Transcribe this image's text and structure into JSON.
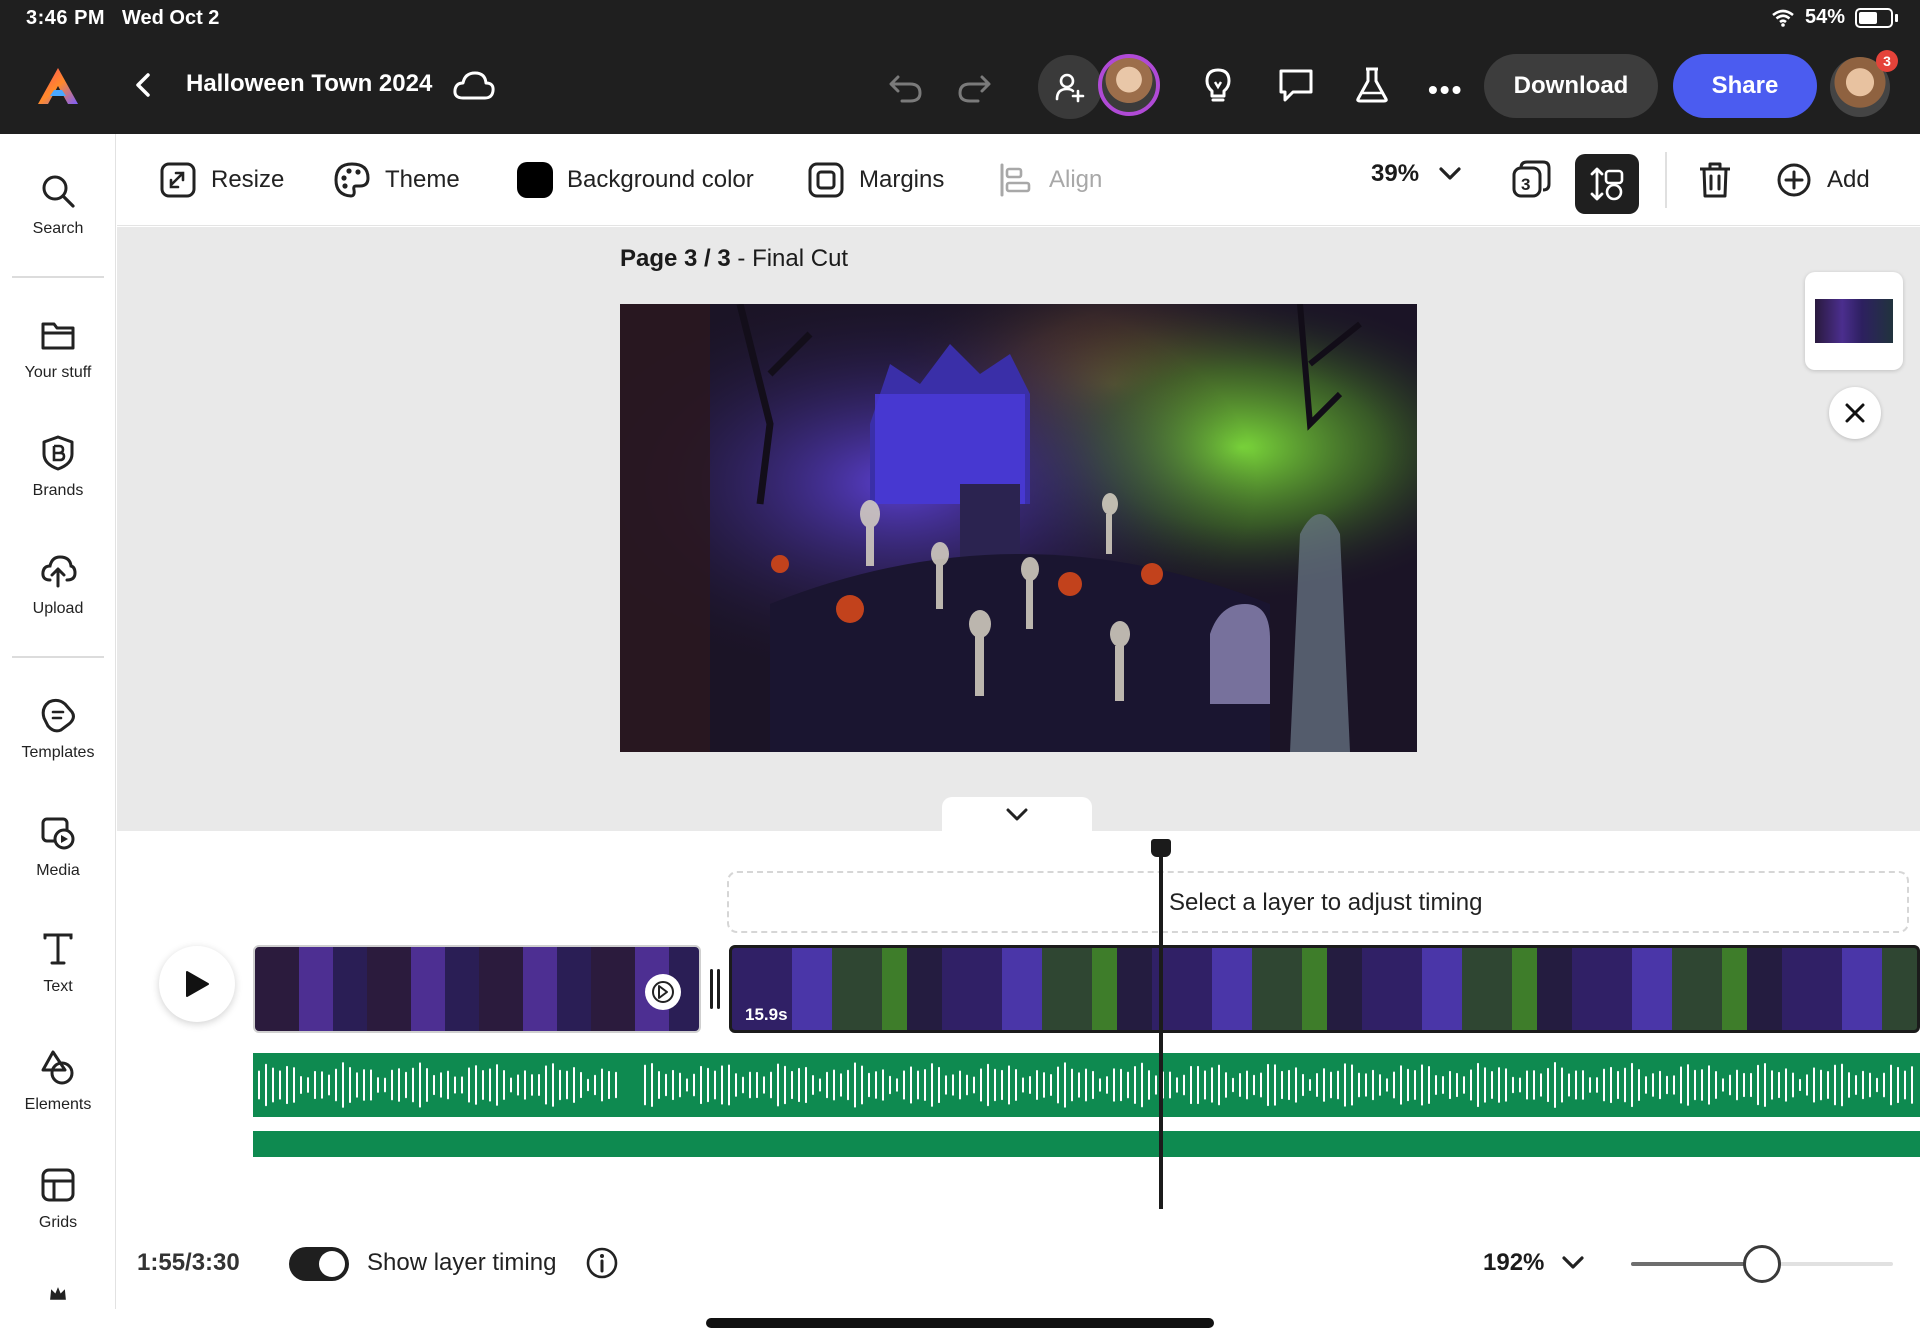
{
  "status_bar": {
    "time": "3:46 PM",
    "date": "Wed Oct 2",
    "battery": "54%"
  },
  "header": {
    "title": "Halloween Town 2024",
    "download_label": "Download",
    "share_label": "Share",
    "notification_count": "3",
    "icons": [
      "adobe-express-logo",
      "back-icon",
      "cloud-icon",
      "undo-icon",
      "redo-icon",
      "invite-icon",
      "lightbulb-icon",
      "comment-icon",
      "flask-icon",
      "more-icon"
    ]
  },
  "sidebar": {
    "items": [
      {
        "label": "Search",
        "icon": "search-icon"
      },
      {
        "label": "Your stuff",
        "icon": "folder-icon"
      },
      {
        "label": "Brands",
        "icon": "brand-icon"
      },
      {
        "label": "Upload",
        "icon": "upload-icon"
      },
      {
        "label": "Templates",
        "icon": "templates-icon"
      },
      {
        "label": "Media",
        "icon": "media-icon"
      },
      {
        "label": "Text",
        "icon": "text-icon"
      },
      {
        "label": "Elements",
        "icon": "elements-icon"
      },
      {
        "label": "Grids",
        "icon": "grids-icon"
      }
    ]
  },
  "toolbar": {
    "resize": "Resize",
    "theme": "Theme",
    "background_color": "Background color",
    "margins": "Margins",
    "align": "Align",
    "zoom": "39%",
    "add": "Add",
    "swatch_color": "#000000"
  },
  "canvas": {
    "page_prefix": "Page 3 / 3",
    "page_name": " - Final Cut"
  },
  "timeline": {
    "hint": "Select a layer to adjust timing",
    "clip_duration": "15.9s",
    "current_time": "1:55/3:30",
    "show_layer_timing": "Show layer timing",
    "show_layer_timing_on": true,
    "zoom": "192%",
    "zoom_slider_fraction": 0.5
  },
  "colors": {
    "accent": "#4b5cf0",
    "audio_track": "#0e8a50",
    "topbar": "#1f1f1f"
  }
}
